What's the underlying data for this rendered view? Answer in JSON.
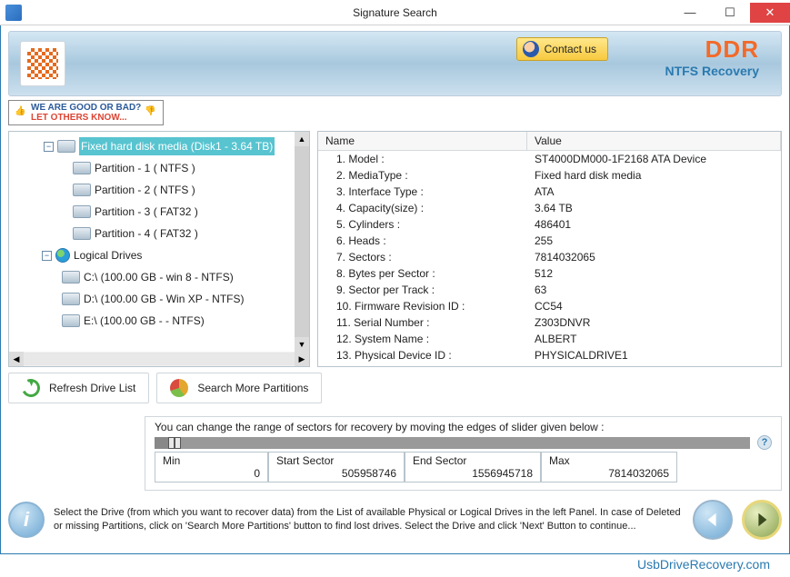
{
  "window": {
    "title": "Signature Search"
  },
  "header": {
    "contact_label": "Contact us",
    "brand": "DDR",
    "subtitle": "NTFS Recovery"
  },
  "feedback": {
    "line1": "WE ARE GOOD OR BAD?",
    "line2": "LET OTHERS KNOW..."
  },
  "tree": {
    "root": {
      "label": "Fixed hard disk media (Disk1 - 3.64 TB)"
    },
    "partitions": [
      "Partition - 1 ( NTFS )",
      "Partition - 2 ( NTFS )",
      "Partition - 3 ( FAT32 )",
      "Partition - 4 ( FAT32 )"
    ],
    "logical_header": "Logical Drives",
    "logical": [
      "C:\\ (100.00 GB - win 8 - NTFS)",
      "D:\\ (100.00 GB - Win XP - NTFS)",
      "E:\\ (100.00 GB -  - NTFS)"
    ]
  },
  "properties": {
    "col_name": "Name",
    "col_value": "Value",
    "rows": [
      {
        "name": "1. Model :",
        "value": "ST4000DM000-1F2168 ATA Device"
      },
      {
        "name": "2. MediaType :",
        "value": "Fixed hard disk media"
      },
      {
        "name": "3. Interface Type :",
        "value": "ATA"
      },
      {
        "name": "4. Capacity(size) :",
        "value": "3.64 TB"
      },
      {
        "name": "5. Cylinders :",
        "value": "486401"
      },
      {
        "name": "6. Heads :",
        "value": "255"
      },
      {
        "name": "7. Sectors :",
        "value": "7814032065"
      },
      {
        "name": "8. Bytes per Sector :",
        "value": "512"
      },
      {
        "name": "9. Sector per Track :",
        "value": "63"
      },
      {
        "name": "10. Firmware Revision ID :",
        "value": "CC54"
      },
      {
        "name": "11. Serial Number :",
        "value": "Z303DNVR"
      },
      {
        "name": "12. System Name :",
        "value": "ALBERT"
      },
      {
        "name": "13. Physical Device ID :",
        "value": "PHYSICALDRIVE1"
      }
    ]
  },
  "buttons": {
    "refresh": "Refresh Drive List",
    "search_more": "Search More Partitions"
  },
  "slider": {
    "caption": "You can change the range of sectors for recovery by moving the edges of slider given below :",
    "min_label": "Min",
    "min_value": "0",
    "start_label": "Start Sector",
    "start_value": "505958746",
    "end_label": "End Sector",
    "end_value": "1556945718",
    "max_label": "Max",
    "max_value": "7814032065"
  },
  "footer": {
    "text": "Select the Drive (from which you want to recover data) from the List of available Physical or Logical Drives in the left Panel. In case of Deleted or missing Partitions, click on 'Search More Partitions' button to find lost drives. Select the Drive and click 'Next' Button to continue..."
  },
  "site_link": "UsbDriveRecovery.com"
}
